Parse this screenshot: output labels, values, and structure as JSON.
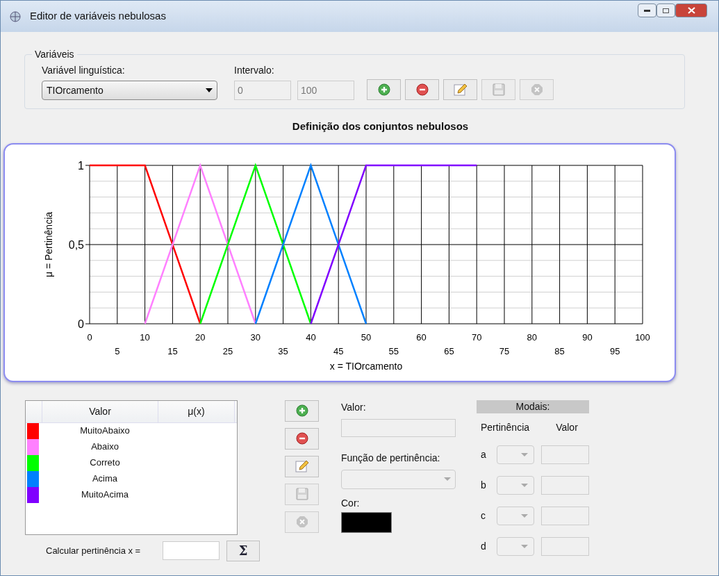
{
  "window": {
    "title": "Editor de variáveis nebulosas"
  },
  "variables": {
    "group_title": "Variáveis",
    "linguistic_label": "Variável linguística:",
    "linguistic_value": "TIOrcamento",
    "interval_label": "Intervalo:",
    "interval_min": "0",
    "interval_max": "100",
    "buttons": [
      {
        "kind": "add",
        "disabled": false
      },
      {
        "kind": "remove",
        "disabled": false
      },
      {
        "kind": "edit",
        "disabled": false
      },
      {
        "kind": "save",
        "disabled": true
      },
      {
        "kind": "cancel",
        "disabled": true
      }
    ]
  },
  "chart_title": "Definição dos conjuntos nebulosos",
  "chart_data": {
    "type": "line",
    "grid": true,
    "xlabel": "x = TIOrcamento",
    "ylabel": "μ = Pertinência",
    "x": [
      0,
      10,
      20,
      30,
      40,
      50,
      60,
      70
    ],
    "xlim": [
      0,
      100
    ],
    "ylim": [
      0,
      1
    ],
    "xticks": [
      {
        "value": 0,
        "label": "0"
      },
      {
        "value": 10,
        "label": "10"
      },
      {
        "value": 20,
        "label": "20"
      },
      {
        "value": 30,
        "label": "30"
      },
      {
        "value": 40,
        "label": "40"
      },
      {
        "value": 50,
        "label": "50"
      },
      {
        "value": 60,
        "label": "60"
      },
      {
        "value": 70,
        "label": "70"
      },
      {
        "value": 80,
        "label": "80"
      },
      {
        "value": 90,
        "label": "90"
      },
      {
        "value": 100,
        "label": "100"
      }
    ],
    "yticks": [
      {
        "value": 0,
        "label": "0"
      },
      {
        "value": 0.5,
        "label": "0,5"
      },
      {
        "value": 1,
        "label": "1"
      }
    ],
    "series": [
      {
        "color": "#ff0000",
        "values": [
          1,
          1,
          0,
          null,
          null,
          null,
          null,
          null
        ]
      },
      {
        "color": "#ff80ff",
        "values": [
          null,
          0,
          1,
          0,
          null,
          null,
          null,
          null
        ]
      },
      {
        "color": "#00ff00",
        "values": [
          null,
          null,
          0,
          1,
          0,
          null,
          null,
          null
        ]
      },
      {
        "color": "#0080ff",
        "values": [
          null,
          null,
          null,
          0,
          1,
          0,
          null,
          null
        ]
      },
      {
        "color": "#8000ff",
        "values": [
          null,
          null,
          null,
          null,
          0,
          1,
          1,
          1
        ]
      }
    ]
  },
  "chart_secondary_xtick_labels": [
    "5",
    "15",
    "25",
    "35",
    "45",
    "55",
    "65",
    "75",
    "85",
    "95"
  ],
  "sets_table": {
    "columns": [
      "Valor",
      "μ(x)"
    ],
    "rows": [
      {
        "value": "MuitoAbaixo",
        "color": "#ff0000"
      },
      {
        "value": "Abaixo",
        "color": "#ff80ff"
      },
      {
        "value": "Correto",
        "color": "#00ff00"
      },
      {
        "value": "Acima",
        "color": "#0080ff"
      },
      {
        "value": "MuitoAcima",
        "color": "#8000ff"
      }
    ]
  },
  "set_buttons": [
    {
      "kind": "add",
      "disabled": false
    },
    {
      "kind": "remove",
      "disabled": false
    },
    {
      "kind": "edit",
      "disabled": false
    },
    {
      "kind": "save",
      "disabled": true
    },
    {
      "kind": "cancel",
      "disabled": true
    }
  ],
  "calc": {
    "label": "Calcular pertinência x =",
    "button": "Σ"
  },
  "set_form": {
    "value_label": "Valor:",
    "function_label": "Função de pertinência:",
    "color_label": "Cor:",
    "color": "#000000"
  },
  "modals": {
    "title": "Modais:",
    "col_membership": "Pertinência",
    "col_value": "Valor",
    "rows": [
      "a",
      "b",
      "c",
      "d"
    ]
  }
}
